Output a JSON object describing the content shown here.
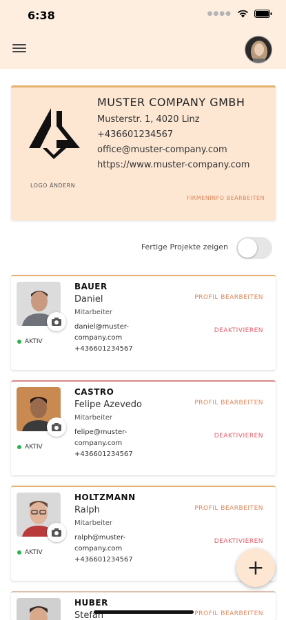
{
  "status_bar": {
    "time": "6:38"
  },
  "header": {
    "menu_icon": "hamburger-menu-icon",
    "avatar": "user-avatar"
  },
  "company": {
    "name": "MUSTER COMPANY GMBH",
    "address": "Musterstr. 1, 4020 Linz",
    "phone": "+436601234567",
    "email": "office@muster-company.com",
    "website": "https://www.muster-company.com",
    "logo_change_label": "LOGO ÄNDERN",
    "edit_label": "FIRMENINFO BEARBEITEN"
  },
  "filter": {
    "label": "Fertige Projekte zeigen",
    "enabled": false
  },
  "employees": [
    {
      "last_name": "BAUER",
      "first_name": "Daniel",
      "role": "Mitarbeiter",
      "email_line1": "daniel@muster-",
      "email_line2": "company.com",
      "phone": "+436601234567",
      "status": "AKTIV",
      "edit_label": "PROFIL BEARBEITEN",
      "deactivate_label": "DEAKTIVIEREN"
    },
    {
      "last_name": "CASTRO",
      "first_name": "Felipe Azevedo",
      "role": "Mitarbeiter",
      "email_line1": "felipe@muster-",
      "email_line2": "company.com",
      "phone": "+436601234567",
      "status": "AKTIV",
      "edit_label": "PROFIL BEARBEITEN",
      "deactivate_label": "DEAKTIVIEREN"
    },
    {
      "last_name": "HOLTZMANN",
      "first_name": "Ralph",
      "role": "Mitarbeiter",
      "email_line1": "ralph@muster-",
      "email_line2": "company.com",
      "phone": "+436601234567",
      "status": "AKTIV",
      "edit_label": "PROFIL BEARBEITEN",
      "deactivate_label": "DEAKTIVIEREN"
    },
    {
      "last_name": "HUBER",
      "first_name": "Stefan",
      "edit_label": "PROFIL BEARBEITEN"
    }
  ],
  "fab": {
    "label": "+"
  },
  "colors": {
    "accent": "#e0865a",
    "danger": "#e15b6a",
    "header_bg": "#fdeee0",
    "card_bg": "#fde7d3",
    "active": "#2bb24c"
  }
}
